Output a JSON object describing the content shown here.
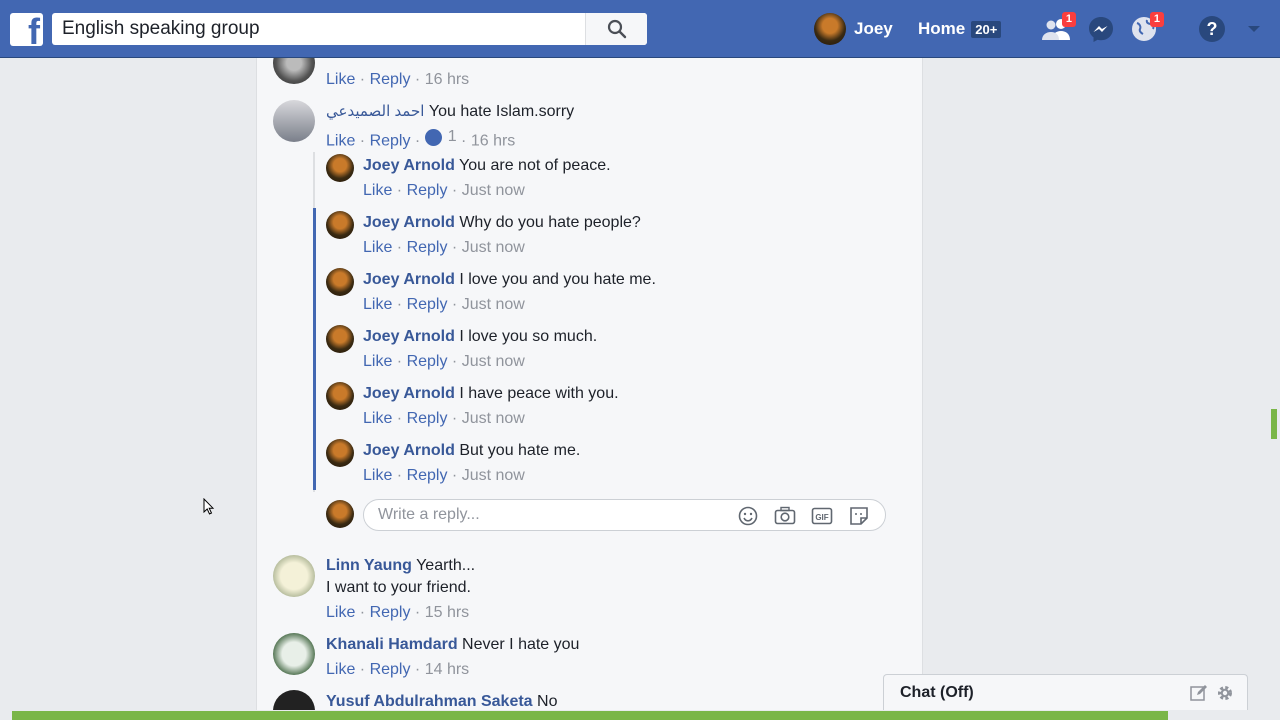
{
  "search": {
    "value": "English speaking group"
  },
  "nav": {
    "user_name": "Joey",
    "home_label": "Home",
    "home_count": "20+",
    "friend_requests_count": "1",
    "notifications_count": "1"
  },
  "comments": [
    {
      "author": "",
      "text": "",
      "like": "Like",
      "reply": "Reply",
      "time": "16 hrs"
    },
    {
      "author": "احمد الصميدعي",
      "text": "You hate Islam.sorry",
      "like": "Like",
      "reply": "Reply",
      "reactions": "1",
      "time": "16 hrs"
    }
  ],
  "replies": [
    {
      "author": "Joey Arnold",
      "text": "You are not of peace.",
      "like": "Like",
      "reply": "Reply",
      "time": "Just now"
    },
    {
      "author": "Joey Arnold",
      "text": "Why do you hate people?",
      "like": "Like",
      "reply": "Reply",
      "time": "Just now"
    },
    {
      "author": "Joey Arnold",
      "text": "I love you and you hate me.",
      "like": "Like",
      "reply": "Reply",
      "time": "Just now"
    },
    {
      "author": "Joey Arnold",
      "text": "I love you so much.",
      "like": "Like",
      "reply": "Reply",
      "time": "Just now"
    },
    {
      "author": "Joey Arnold",
      "text": "I have peace with you.",
      "like": "Like",
      "reply": "Reply",
      "time": "Just now"
    },
    {
      "author": "Joey Arnold",
      "text": "But you hate me.",
      "like": "Like",
      "reply": "Reply",
      "time": "Just now"
    }
  ],
  "reply_box": {
    "placeholder": "Write a reply..."
  },
  "more_comments": [
    {
      "author": "Linn Yaung",
      "text": "Yearth...",
      "text2": "I want to your friend.",
      "like": "Like",
      "reply": "Reply",
      "time": "15 hrs"
    },
    {
      "author": "Khanali Hamdard",
      "text": "Never I hate you",
      "like": "Like",
      "reply": "Reply",
      "time": "14 hrs"
    },
    {
      "author": "Yusuf Abdulrahman Saketa",
      "text": "No"
    }
  ],
  "chat": {
    "label": "Chat (Off)"
  },
  "colors": {
    "brand": "#4267b2",
    "link": "#385898",
    "meta": "#90949c",
    "scroll_accent": "#7ab648"
  }
}
